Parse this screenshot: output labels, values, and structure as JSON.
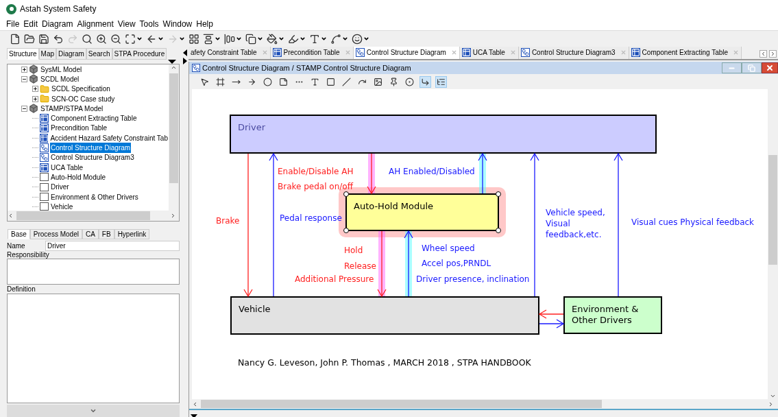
{
  "window": {
    "title": "Astah System Safety"
  },
  "menu": [
    "File",
    "Edit",
    "Diagram",
    "Alignment",
    "View",
    "Tools",
    "Window",
    "Help"
  ],
  "toolbar": [
    {
      "kind": "new",
      "menu": false,
      "disabled": false
    },
    {
      "kind": "open",
      "menu": false,
      "disabled": false
    },
    {
      "kind": "save",
      "menu": false,
      "disabled": false
    },
    {
      "kind": "undo",
      "menu": false,
      "disabled": false
    },
    {
      "kind": "redo",
      "menu": false,
      "disabled": true
    },
    {
      "kind": "search",
      "menu": false,
      "disabled": false
    },
    {
      "kind": "zoom-in",
      "menu": false,
      "disabled": false
    },
    {
      "kind": "zoom-out",
      "menu": false,
      "disabled": false
    },
    {
      "kind": "fit",
      "menu": true,
      "disabled": false
    },
    {
      "kind": "back",
      "menu": true,
      "disabled": false
    },
    {
      "kind": "forward",
      "menu": true,
      "disabled": true
    },
    {
      "kind": "layout",
      "menu": false,
      "disabled": false
    },
    {
      "kind": "align-top",
      "menu": true,
      "disabled": false
    },
    {
      "kind": "align-left",
      "menu": true,
      "disabled": false
    },
    {
      "kind": "arrange",
      "menu": true,
      "disabled": false
    },
    {
      "kind": "fill",
      "menu": true,
      "disabled": false
    },
    {
      "kind": "pen",
      "menu": true,
      "disabled": false
    },
    {
      "kind": "font",
      "menu": true,
      "disabled": false
    },
    {
      "kind": "line",
      "menu": true,
      "disabled": false
    },
    {
      "kind": "smiley",
      "menu": true,
      "disabled": false
    }
  ],
  "left_tabs": [
    {
      "label": "Structure",
      "selected": true
    },
    {
      "label": "Map",
      "selected": false
    },
    {
      "label": "Diagram",
      "selected": false
    },
    {
      "label": "Search",
      "selected": false
    },
    {
      "label": "STPA Procedure",
      "selected": false
    }
  ],
  "tree": [
    {
      "label": "SysML Model",
      "kind": "model",
      "expanded": false,
      "selected": false
    },
    {
      "label": "SCDL Model",
      "kind": "model",
      "expanded": true,
      "selected": false,
      "children": [
        {
          "label": "SCDL Specification",
          "kind": "folder",
          "expanded": false,
          "selected": false
        },
        {
          "label": "SCN-OC Case study",
          "kind": "folder",
          "expanded": false,
          "selected": false
        }
      ]
    },
    {
      "label": "STAMP/STPA Model",
      "kind": "model",
      "expanded": true,
      "selected": false,
      "children": [
        {
          "label": "Component Extracting Table",
          "kind": "table",
          "selected": false
        },
        {
          "label": "Precondition Table",
          "kind": "table",
          "selected": false
        },
        {
          "label": "Accident Hazard Safety Constraint Tab",
          "kind": "table",
          "selected": false
        },
        {
          "label": "Control Structure Diagram",
          "kind": "diagram",
          "selected": true
        },
        {
          "label": "Control Structure Diagram3",
          "kind": "diagram",
          "selected": false
        },
        {
          "label": "UCA Table",
          "kind": "table",
          "selected": false
        },
        {
          "label": "Auto-Hold Module",
          "kind": "component",
          "selected": false
        },
        {
          "label": "Driver",
          "kind": "component",
          "selected": false
        },
        {
          "label": "Environment & Other Drivers",
          "kind": "component",
          "selected": false
        },
        {
          "label": "Vehicle",
          "kind": "component",
          "selected": false
        }
      ]
    }
  ],
  "property_tabs": [
    {
      "label": "Base",
      "selected": true
    },
    {
      "label": "Process Model",
      "selected": false
    },
    {
      "label": "CA",
      "selected": false
    },
    {
      "label": "FB",
      "selected": false
    },
    {
      "label": "Hyperlink",
      "selected": false
    }
  ],
  "properties": {
    "name_label": "Name",
    "name_value": "Driver",
    "responsibility_label": "Responsibility",
    "definition_label": "Definition"
  },
  "doc_tabs": [
    {
      "label": "afety Constraint Table",
      "kind": "none",
      "selected": false
    },
    {
      "label": "Precondition Table",
      "kind": "table",
      "selected": false
    },
    {
      "label": "Control Structure Diagram",
      "kind": "diagram",
      "selected": true
    },
    {
      "label": "UCA Table",
      "kind": "table",
      "selected": false
    },
    {
      "label": "Control Structure Diagram3",
      "kind": "diagram",
      "selected": false
    },
    {
      "label": "Component Extracting Table",
      "kind": "table",
      "selected": false
    }
  ],
  "diagram_window": {
    "title": "Control Structure Diagram / STAMP Control Structure Diagram"
  },
  "diagram_toolbar": [
    {
      "kind": "pointer",
      "selected": false
    },
    {
      "kind": "frame",
      "selected": false
    },
    {
      "kind": "arrow",
      "selected": false
    },
    {
      "kind": "dashed-arrow",
      "selected": false
    },
    {
      "kind": "dot",
      "selected": false
    },
    {
      "kind": "note",
      "selected": false
    },
    {
      "kind": "dashes",
      "selected": false
    },
    {
      "kind": "text",
      "selected": false
    },
    {
      "kind": "rect",
      "selected": false
    },
    {
      "kind": "slash",
      "selected": false
    },
    {
      "kind": "curve",
      "selected": false
    },
    {
      "kind": "image",
      "selected": false
    },
    {
      "kind": "pin",
      "selected": false
    },
    {
      "kind": "target",
      "selected": false
    },
    {
      "kind": "elbow",
      "selected": true
    },
    {
      "kind": "tree",
      "selected": true
    }
  ],
  "diagram": {
    "nodes": [
      {
        "label": "Driver",
        "color": "#ccccff",
        "selected": false
      },
      {
        "label": "Auto-Hold Module",
        "color": "#ffff99",
        "selected": true
      },
      {
        "label": "Vehicle",
        "color": "#e2e2e2",
        "selected": false
      },
      {
        "label": "Environment & Other Drivers",
        "color": "#ccffcc",
        "selected": false
      }
    ],
    "connectors": [
      {
        "kind": "control",
        "highlighted": false
      },
      {
        "kind": "feedback",
        "highlighted": false
      },
      {
        "kind": "control",
        "highlighted": true
      },
      {
        "kind": "feedback",
        "highlighted": true
      },
      {
        "kind": "control",
        "highlighted": true
      },
      {
        "kind": "feedback",
        "highlighted": true
      },
      {
        "kind": "feedback",
        "highlighted": false
      },
      {
        "kind": "feedback",
        "highlighted": false
      },
      {
        "kind": "control",
        "highlighted": false
      },
      {
        "kind": "feedback",
        "highlighted": false
      }
    ],
    "labels": [
      {
        "text": "Brake",
        "kind": "control"
      },
      {
        "text": "Enable/Disable AH",
        "kind": "control"
      },
      {
        "text": "Brake pedal on/off",
        "kind": "control"
      },
      {
        "text": "AH Enabled/Disabled",
        "kind": "feedback"
      },
      {
        "text": "Pedal response",
        "kind": "feedback"
      },
      {
        "text": "Hold",
        "kind": "control"
      },
      {
        "text": "Release",
        "kind": "control"
      },
      {
        "text": "Additional Pressure",
        "kind": "control"
      },
      {
        "text": "Wheel speed",
        "kind": "feedback"
      },
      {
        "text": "Accel pos,PRNDL",
        "kind": "feedback"
      },
      {
        "text": "Driver presence, inclination",
        "kind": "feedback"
      },
      {
        "text": "Vehicle speed,\nVisual\nfeedback,etc.",
        "kind": "feedback"
      },
      {
        "text": "Visual cues Physical feedback",
        "kind": "feedback"
      }
    ],
    "citation": "Nancy G. Leveson, John P. Thomas , MARCH 2018 , STPA HANDBOOK"
  }
}
